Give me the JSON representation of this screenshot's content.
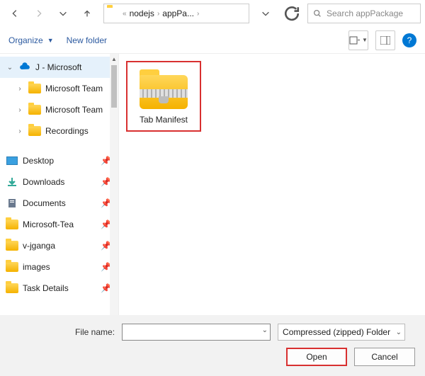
{
  "nav": {
    "path_segments": [
      "nodejs",
      "appPa..."
    ],
    "search_placeholder": "Search appPackage"
  },
  "toolbar": {
    "organize_label": "Organize",
    "newfolder_label": "New folder"
  },
  "sidebar": {
    "root": {
      "label": "J - Microsoft"
    },
    "tree": [
      {
        "label": "Microsoft Team"
      },
      {
        "label": "Microsoft Team"
      },
      {
        "label": "Recordings"
      }
    ],
    "quick": [
      {
        "label": "Desktop",
        "kind": "desktop",
        "pinned": true
      },
      {
        "label": "Downloads",
        "kind": "downloads",
        "pinned": true
      },
      {
        "label": "Documents",
        "kind": "documents",
        "pinned": true
      },
      {
        "label": "Microsoft-Tea",
        "kind": "folder",
        "pinned": true
      },
      {
        "label": "v-jganga",
        "kind": "folder",
        "pinned": true
      },
      {
        "label": "images",
        "kind": "folder",
        "pinned": true
      },
      {
        "label": "Task Details",
        "kind": "folder",
        "pinned": true
      }
    ]
  },
  "content": {
    "items": [
      {
        "label": "Tab Manifest"
      }
    ]
  },
  "footer": {
    "filename_label": "File name:",
    "filename_value": "",
    "filetype_label": "Compressed (zipped) Folder",
    "open_label": "Open",
    "cancel_label": "Cancel"
  }
}
